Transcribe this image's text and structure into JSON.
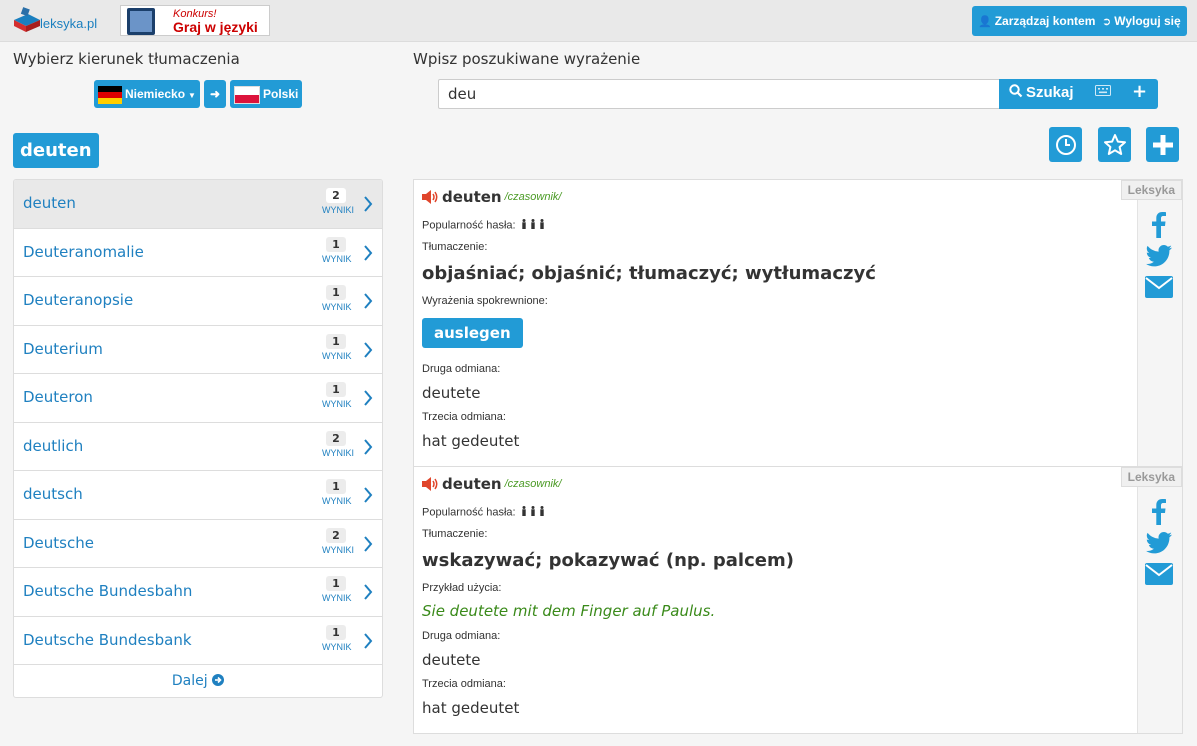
{
  "topbar": {
    "logo_text": "leksyka.pl",
    "banner_line1": "Konkurs!",
    "banner_line2": "Graj w języki",
    "manage_account": "Zarządzaj kontem",
    "logout": "Wyloguj się"
  },
  "direction": {
    "heading": "Wybierz kierunek tłumaczenia",
    "source_lang": "Niemiecko",
    "target_lang": "Polski"
  },
  "search": {
    "heading": "Wpisz poszukiwane wyrażenie",
    "value": "deu",
    "button_label": "Szukaj"
  },
  "current_term": "deuten",
  "results": {
    "items": [
      {
        "label": "deuten",
        "count": "2",
        "unit": "WYNIKI"
      },
      {
        "label": "Deuteranomalie",
        "count": "1",
        "unit": "WYNIK"
      },
      {
        "label": "Deuteranopsie",
        "count": "1",
        "unit": "WYNIK"
      },
      {
        "label": "Deuterium",
        "count": "1",
        "unit": "WYNIK"
      },
      {
        "label": "Deuteron",
        "count": "1",
        "unit": "WYNIK"
      },
      {
        "label": "deutlich",
        "count": "2",
        "unit": "WYNIKI"
      },
      {
        "label": "deutsch",
        "count": "1",
        "unit": "WYNIK"
      },
      {
        "label": "Deutsche",
        "count": "2",
        "unit": "WYNIKI"
      },
      {
        "label": "Deutsche Bundesbahn",
        "count": "1",
        "unit": "WYNIK"
      },
      {
        "label": "Deutsche Bundesbank",
        "count": "1",
        "unit": "WYNIK"
      }
    ],
    "more_label": "Dalej"
  },
  "entries": [
    {
      "word": "deuten",
      "pos": "/czasownik/",
      "source_tag": "Leksyka",
      "popularity_label": "Popularność hasła:",
      "translation_label": "Tłumaczenie:",
      "translation": "objaśniać; objaśnić; tłumaczyć; wytłumaczyć",
      "related_label": "Wyrażenia spokrewnione:",
      "related": "auslegen",
      "form2_label": "Druga odmiana:",
      "form2": "deutete",
      "form3_label": "Trzecia odmiana:",
      "form3": "hat gedeutet"
    },
    {
      "word": "deuten",
      "pos": "/czasownik/",
      "source_tag": "Leksyka",
      "popularity_label": "Popularność hasła:",
      "translation_label": "Tłumaczenie:",
      "translation": "wskazywać; pokazywać (np. palcem)",
      "example_label": "Przykład użycia:",
      "example": "Sie deutete mit dem Finger auf Paulus.",
      "form2_label": "Druga odmiana:",
      "form2": "deutete",
      "form3_label": "Trzecia odmiana:",
      "form3": "hat gedeutet"
    }
  ],
  "colors": {
    "accent": "#229bd6",
    "link": "#1f80c0",
    "example_green": "#3a8a1a",
    "speaker_red": "#e0452b"
  }
}
